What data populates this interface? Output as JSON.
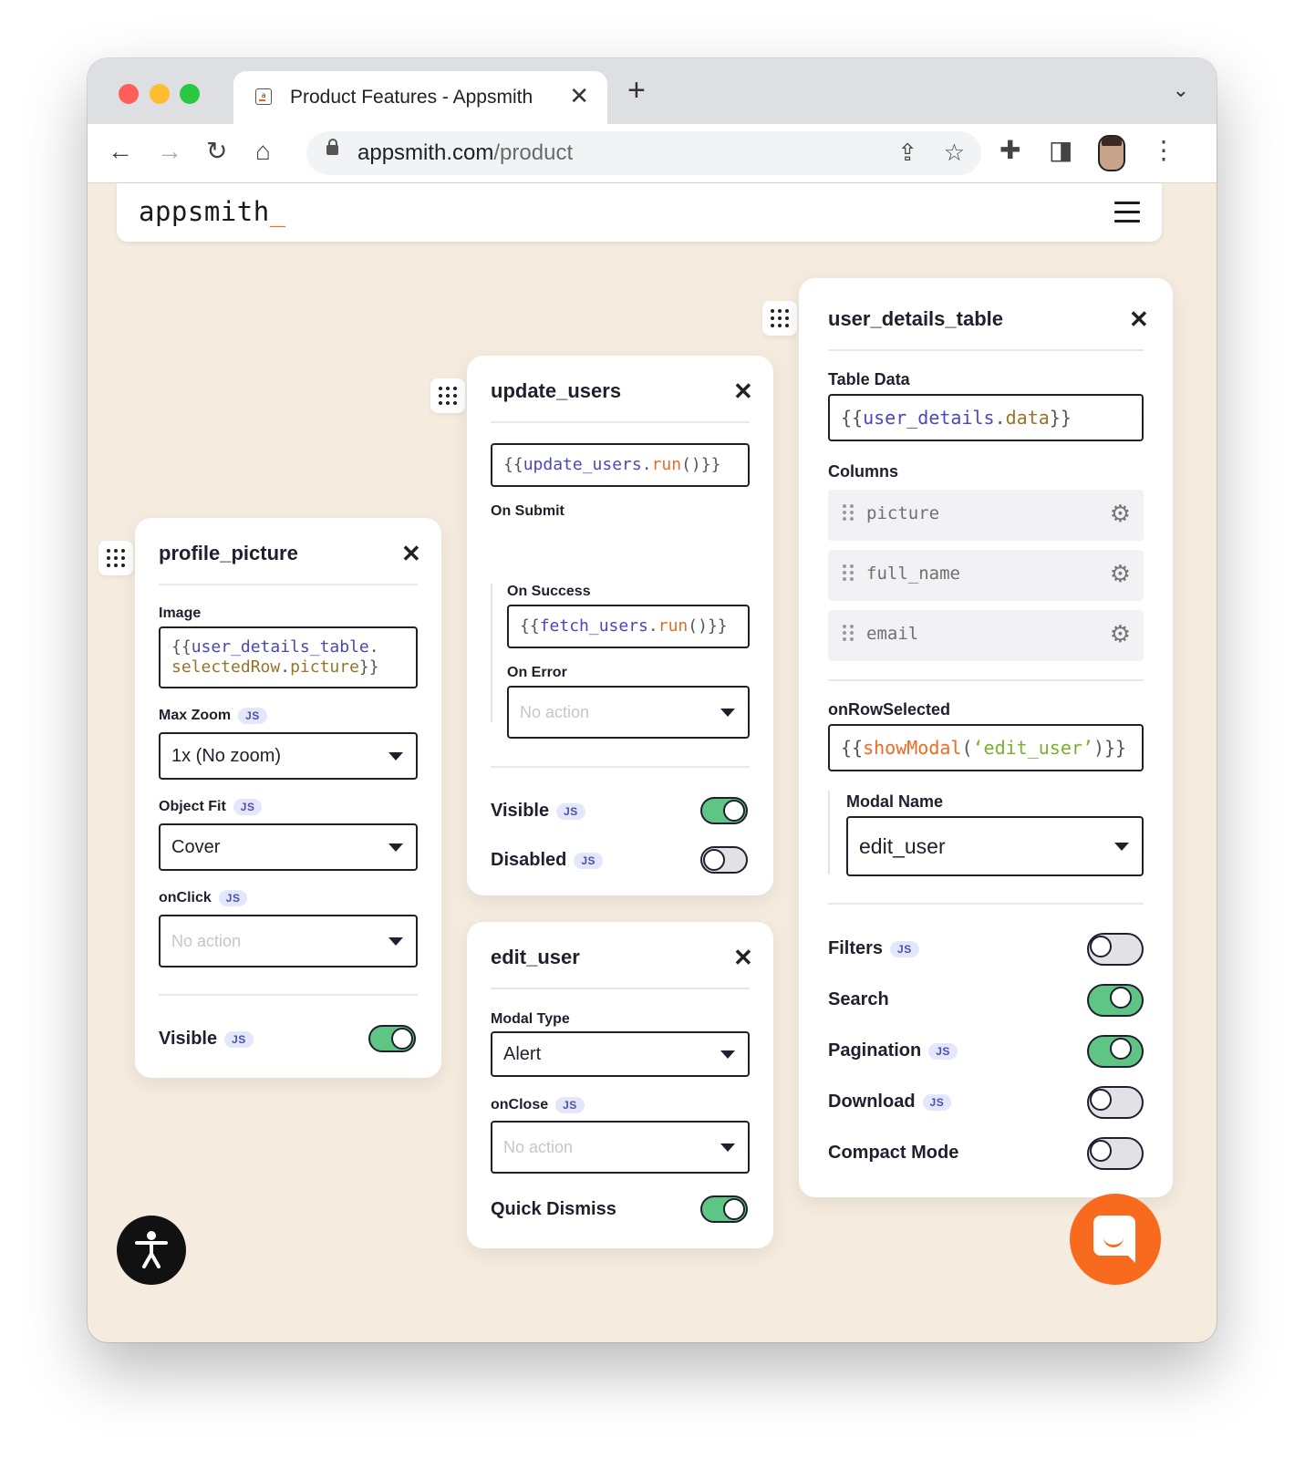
{
  "browser": {
    "tab_title": "Product Features - Appsmith",
    "url_host": "appsmith.com",
    "url_path": "/product",
    "colors": {
      "close": "#ff5f57",
      "minimize": "#febc2e",
      "maximize": "#28c840"
    }
  },
  "app": {
    "logo": "appsmith",
    "logo_suffix": "_",
    "accent": "#f86a2b"
  },
  "profile_picture": {
    "title": "profile_picture",
    "image_label": "Image",
    "image_value_line1": "{{user_details_table.",
    "image_value_line2": "selectedRow.picture}}",
    "max_zoom_label": "Max Zoom",
    "max_zoom_value": "1x (No zoom)",
    "object_fit_label": "Object Fit",
    "object_fit_value": "Cover",
    "onclick_label": "onClick",
    "onclick_placeholder": "No action",
    "visible_label": "Visible",
    "visible_on": true
  },
  "update_users": {
    "title": "update_users",
    "on_submit_value": "{{update_users.run()}}",
    "on_submit_label": "On Submit",
    "on_success_label": "On Success",
    "on_success_value": "{{fetch_users.run()}}",
    "on_error_label": "On Error",
    "on_error_placeholder": "No action",
    "visible_label": "Visible",
    "visible_on": true,
    "disabled_label": "Disabled",
    "disabled_on": false
  },
  "edit_user": {
    "title": "edit_user",
    "modal_type_label": "Modal Type",
    "modal_type_value": "Alert",
    "onclose_label": "onClose",
    "onclose_placeholder": "No action",
    "quick_dismiss_label": "Quick Dismiss",
    "quick_dismiss_on": true
  },
  "user_details_table": {
    "title": "user_details_table",
    "table_data_label": "Table Data",
    "table_data_value": "{{user_details.data}}",
    "columns_label": "Columns",
    "columns": [
      "picture",
      "full_name",
      "email"
    ],
    "on_row_selected_label": "onRowSelected",
    "on_row_selected_value": "{{showModal(‘edit_user’)}}",
    "modal_name_label": "Modal Name",
    "modal_name_value": "edit_user",
    "toggles": [
      {
        "label": "Filters",
        "js": true,
        "on": false
      },
      {
        "label": "Search",
        "js": false,
        "on": true
      },
      {
        "label": "Pagination",
        "js": true,
        "on": true
      },
      {
        "label": "Download",
        "js": true,
        "on": false
      },
      {
        "label": "Compact Mode",
        "js": false,
        "on": false
      }
    ]
  },
  "js_badge": "JS"
}
